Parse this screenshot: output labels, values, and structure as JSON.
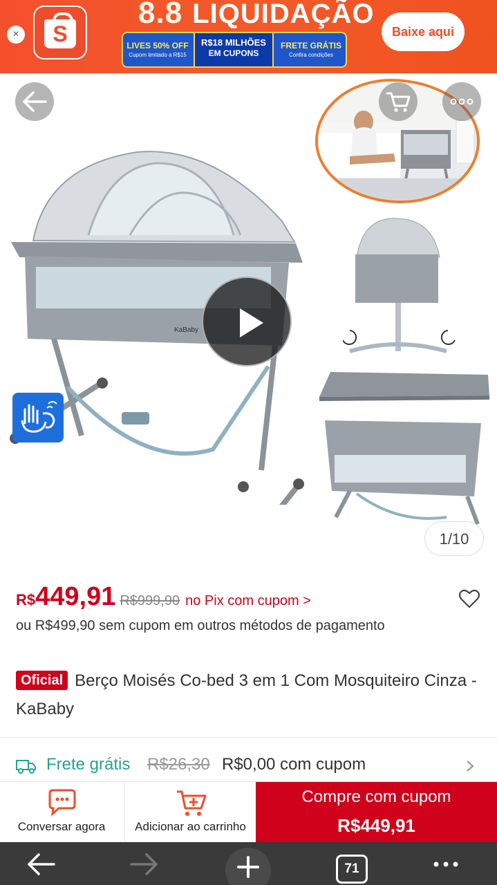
{
  "banner": {
    "promo_number": "8.8",
    "promo_word": "LIQUIDAÇÃO",
    "pill1_big": "LIVES 50% OFF",
    "pill1_small": "Cupom limitado a R$15",
    "pill2_line1": "R$18 MILHÕES",
    "pill2_line2": "EM CUPONS",
    "pill3_big": "FRETE GRÁTIS",
    "pill3_small": "Confira condições",
    "download_label": "Baixe aqui",
    "brand_letter": "S",
    "close_symbol": "×"
  },
  "gallery": {
    "counter": "1/10",
    "crib_brand": "KaBaby"
  },
  "price": {
    "currency": "R$",
    "value": "449,91",
    "old_price": "R$999,90",
    "pix_note": "no Pix com cupom >",
    "alt_price": "ou R$499,90 sem cupom em outros métodos de pagamento"
  },
  "product": {
    "badge": "Oficial",
    "title": "Berço Moisés Co-bed 3 em 1 Com Mosquiteiro Cinza - KaBaby"
  },
  "shipping": {
    "free_label": "Frete grátis",
    "old_price": "R$26,30",
    "new_price": "R$0,00 com cupom"
  },
  "actions": {
    "chat_label": "Conversar agora",
    "cart_label": "Adicionar ao carrinho",
    "buy_label": "Compre com cupom",
    "buy_price": "R$449,91"
  },
  "browser": {
    "tab_count": "71"
  },
  "colors": {
    "shopee_orange": "#ee4d2d",
    "price_red": "#d0011b",
    "free_shipping_green": "#24a38e"
  }
}
